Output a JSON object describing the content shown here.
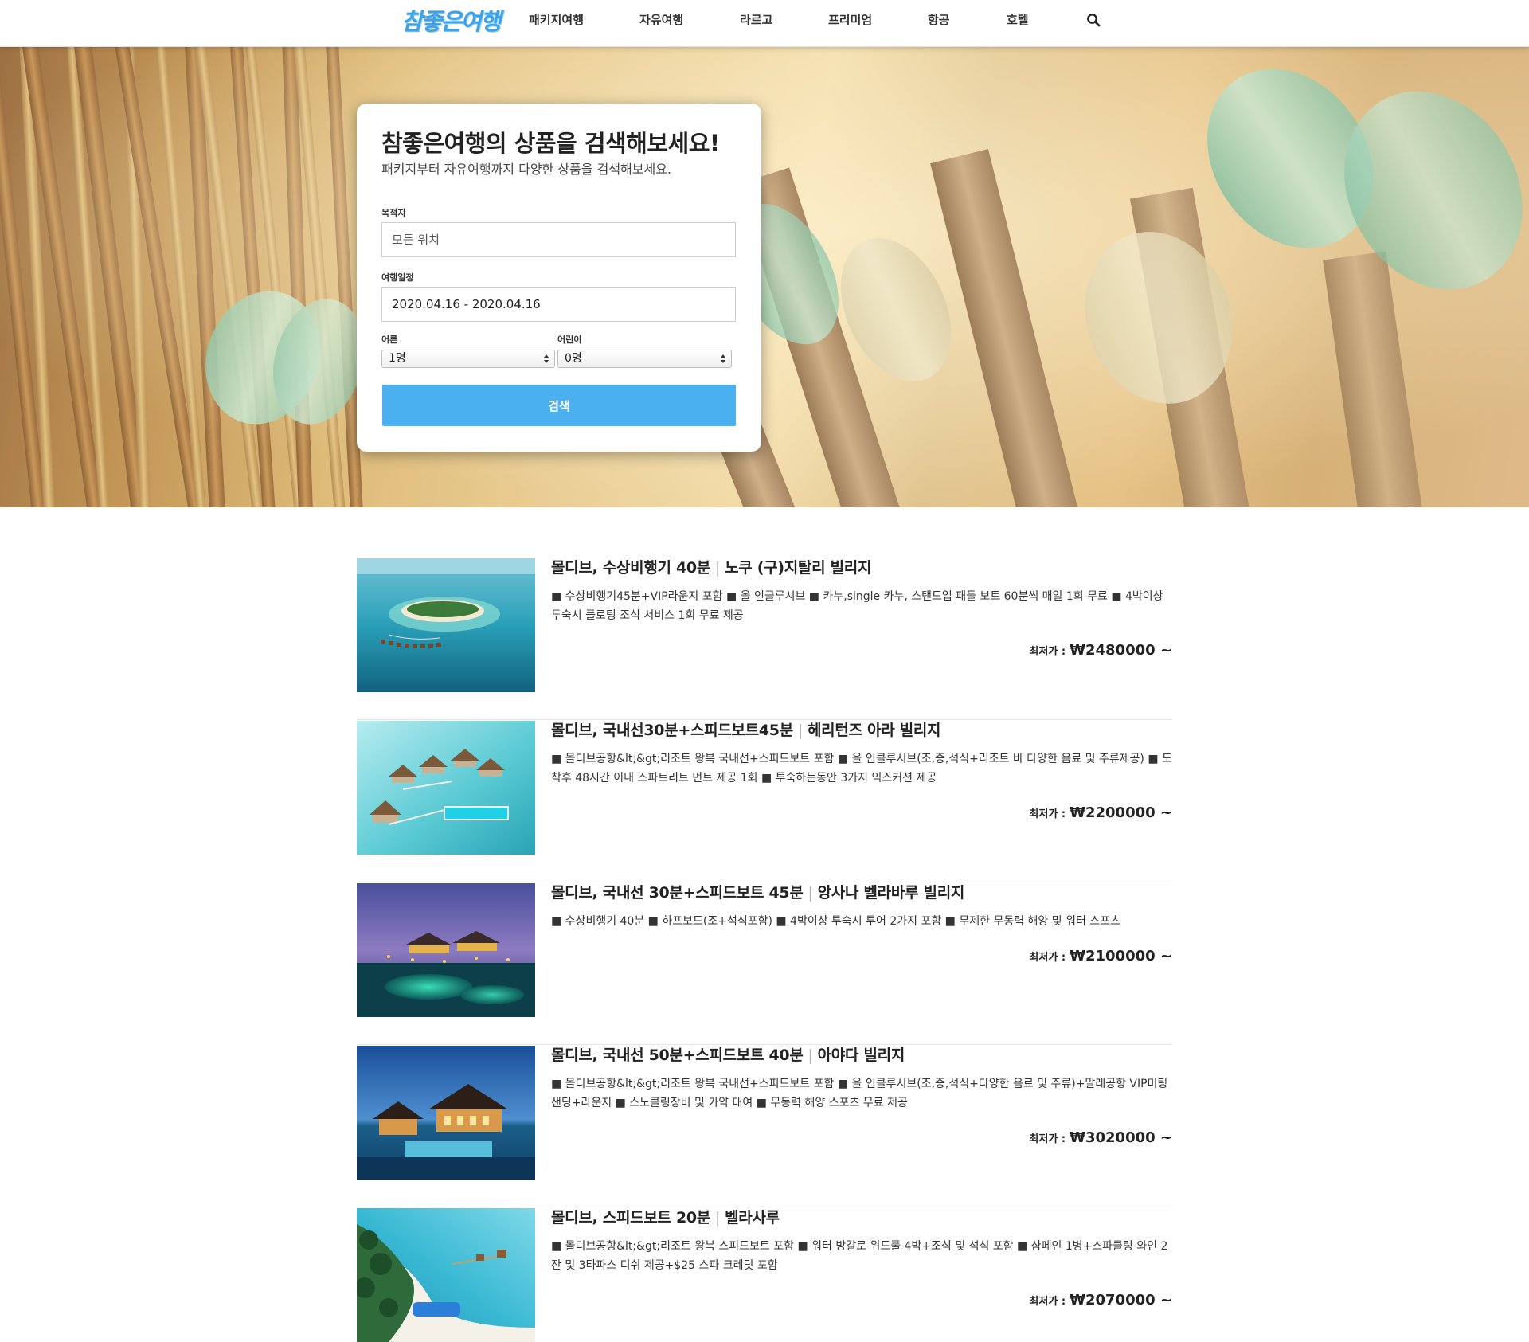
{
  "header": {
    "logo_text": "참좋은여행",
    "nav": [
      "패키지여행",
      "자유여행",
      "라르고",
      "프리미엄",
      "항공",
      "호텔"
    ],
    "search_icon": "search-icon"
  },
  "search": {
    "title": "참좋은여행의 상품을 검색해보세요!",
    "subtitle": "패키지부터 자유여행까지 다양한 상품을 검색해보세요.",
    "destination_label": "목적지",
    "destination_value": "모든 위치",
    "dates_label": "여행일정",
    "dates_value": "2020.04.16 - 2020.04.16",
    "adults_label": "어른",
    "adults_value": "1명",
    "children_label": "어린이",
    "children_value": "0명",
    "button_label": "검색"
  },
  "products": [
    {
      "title_main": "몰디브, 수상비행기 40분",
      "title_sep": "|",
      "title_sub": "노쿠 (구)지탈리 빌리지",
      "description": "■ 수상비행기45분+VIP라운지 포함 ■ 올 인클루시브 ■ 카누,single 카누, 스탠드업 패들 보트 60분씩 매일 1회 무료 ■ 4박이상 투숙시 플로팅 조식 서비스 1회 무료 제공",
      "price_label": "최저가 :",
      "price_value": "₩2480000 ~"
    },
    {
      "title_main": "몰디브, 국내선30분+스피드보트45분",
      "title_sep": "|",
      "title_sub": "헤리턴즈 아라 빌리지",
      "description": "■ 몰디브공항&lt;&gt;리조트 왕복 국내선+스피드보트 포함 ■ 올 인클루시브(조,중,석식+리조트 바 다양한 음료 및 주류제공) ■ 도착후 48시간 이내 스파트리트 먼트 제공 1회 ■ 투숙하는동안 3가지 익스커션 제공",
      "price_label": "최저가 :",
      "price_value": "₩2200000 ~"
    },
    {
      "title_main": "몰디브, 국내선 30분+스피드보트 45분",
      "title_sep": "|",
      "title_sub": "앙사나 벨라바루 빌리지",
      "description": "■ 수상비행기 40분 ■ 하프보드(조+석식포함) ■ 4박이상 투숙시 투어 2가지 포함 ■ 무제한 무동력 해양 및 워터 스포츠",
      "price_label": "최저가 :",
      "price_value": "₩2100000 ~"
    },
    {
      "title_main": "몰디브, 국내선 50분+스피드보트 40분",
      "title_sep": "|",
      "title_sub": "아야다 빌리지",
      "description": "■ 몰디브공항&lt;&gt;리조트 왕복 국내선+스피드보트 포함 ■ 올 인클루시브(조,중,석식+다양한 음료 및 주류)+말레공항 VIP미팅샌딩+라운지 ■ 스노클링장비 및 카약 대여 ■ 무동력 해양 스포츠 무료 제공",
      "price_label": "최저가 :",
      "price_value": "₩3020000 ~"
    },
    {
      "title_main": "몰디브, 스피드보트 20분",
      "title_sep": "|",
      "title_sub": "벨라사루",
      "description": "■ 몰디브공항&lt;&gt;리조트 왕복 스피드보트 포함 ■ 워터 방갈로 위드풀 4박+조식 및 석식 포함 ■ 샴페인 1병+스파클링 와인 2잔 및 3타파스 디쉬 제공+$25 스파 크레딧 포함",
      "price_label": "최저가 :",
      "price_value": "₩2070000 ~"
    }
  ]
}
